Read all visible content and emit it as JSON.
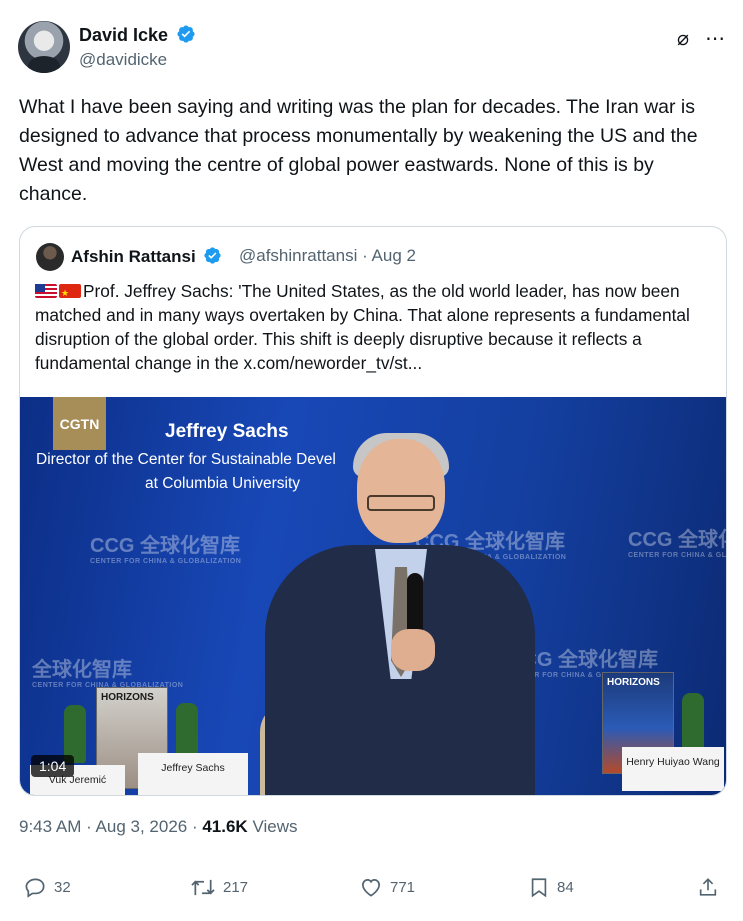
{
  "author": {
    "name": "David Icke",
    "handle": "@davidicke",
    "avatar_icon": "profile-photo"
  },
  "tweet": {
    "text": "What I have been saying and writing was the plan for decades. The Iran war is designed to advance that process monumentally by weakening the US and the West and moving the centre of global power eastwards. None of this is by chance."
  },
  "quote": {
    "name": "Afshin Rattansi",
    "meta": "@afshinrattansi · Aug 2",
    "text": "Prof. Jeffrey Sachs: 'The United States, as the old world leader, has now been matched and in many ways overtaken by China. That alone represents a fundamental disruption of the global order. This shift is deeply disruptive because it reflects a fundamental change in the  x.com/neworder_tv/st..."
  },
  "video": {
    "logo": "CGTN",
    "title": "Jeffrey Sachs",
    "subtitle": "Director of the Center for Sustainable Devel",
    "subtitle2": "at Columbia University",
    "watermark": "CCG 全球化智库",
    "watermark2": "全球化智库",
    "watermark_small": "CENTER FOR CHINA & GLOBALIZATION",
    "book_title": "HORIZONS",
    "plate_left": "Vuk Jeremić",
    "plate_center": "Jeffrey Sachs",
    "plate_right": "Henry Huiyao Wang",
    "duration": "1:04"
  },
  "meta": {
    "time": "9:43 AM · Aug 3, 2026 · ",
    "views_count": "41.6K",
    "views_label": " Views"
  },
  "actions": {
    "replies": "32",
    "reposts": "217",
    "likes": "771",
    "bookmarks": "84"
  }
}
